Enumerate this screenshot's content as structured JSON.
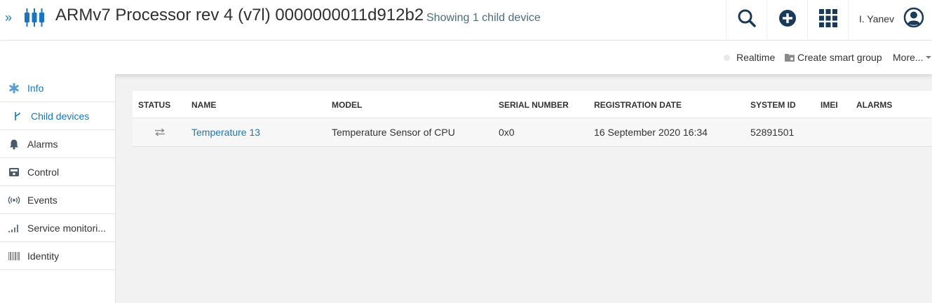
{
  "header": {
    "expand_glyph": "»",
    "device_icon": "device-icon",
    "title": "ARMv7 Processor rev 4 (v7l) 0000000011d912b2",
    "subtitle": "Showing 1 child device",
    "buttons": [
      "search-icon",
      "plus-circle-icon",
      "app-grid-icon"
    ],
    "user_name": "I. Yanev",
    "user_icon": "user-circle-icon"
  },
  "actionbar": {
    "realtime": "Realtime",
    "create_smart_group": "Create smart group",
    "more": "More..."
  },
  "sidebar": {
    "items": [
      {
        "label": "Info",
        "icon": "asterisk-icon",
        "active": true
      },
      {
        "label": "Child devices",
        "icon": "branch-icon",
        "active": true
      },
      {
        "label": "Alarms",
        "icon": "bell-icon"
      },
      {
        "label": "Control",
        "icon": "control-icon"
      },
      {
        "label": "Events",
        "icon": "broadcast-icon"
      },
      {
        "label": "Service monitori...",
        "icon": "signal-bars-icon"
      },
      {
        "label": "Identity",
        "icon": "barcode-icon"
      }
    ]
  },
  "table": {
    "columns": [
      "STATUS",
      "NAME",
      "MODEL",
      "SERIAL NUMBER",
      "REGISTRATION DATE",
      "SYSTEM ID",
      "IMEI",
      "ALARMS"
    ],
    "rows": [
      {
        "status_icon": "exchange-arrows-icon",
        "name": "Temperature 13",
        "model": "Temperature Sensor of CPU",
        "serial": "0x0",
        "registration_date": "16 September 2020 16:34",
        "system_id": "52891501",
        "imei": "",
        "alarms": ""
      }
    ]
  },
  "colors": {
    "accent": "#1776bf",
    "background": "#f2f2f2"
  }
}
